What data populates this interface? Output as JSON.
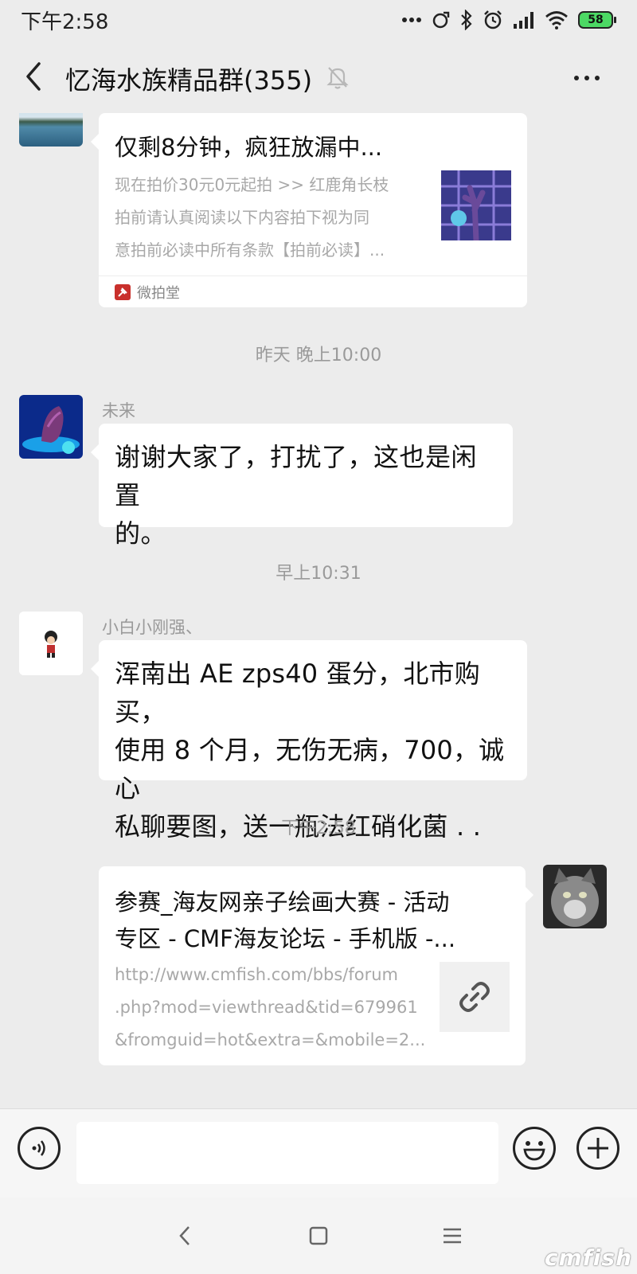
{
  "status_bar": {
    "time": "下午2:58",
    "battery": "58",
    "colors": {
      "battery_fill": "#4cd964"
    },
    "icons": [
      "more-dots-icon",
      "alarm-ring-icon",
      "bluetooth-icon",
      "alarm-clock-icon",
      "signal-icon",
      "wifi-icon",
      "battery-icon"
    ]
  },
  "header": {
    "title": "忆海水族精品群(355)",
    "back_icon": "chevron-left-icon",
    "mute_icon": "bell-off-icon",
    "more_icon": "more-horizontal-icon"
  },
  "messages": [
    {
      "type": "card",
      "side": "left",
      "title": "仅剩8分钟，疯狂放漏中...",
      "description": [
        "现在拍价30元0元起拍 >> 红鹿角长枝",
        "拍前请认真阅读以下内容拍下视为同",
        "意拍前必读中所有条款【拍前必读】..."
      ],
      "source": "微拍堂"
    },
    {
      "type": "timestamp",
      "text": "昨天 晚上10:00"
    },
    {
      "type": "text",
      "side": "left",
      "sender": "未来",
      "lines": [
        "谢谢大家了，打扰了，这也是闲置",
        "的。"
      ]
    },
    {
      "type": "timestamp",
      "text": "早上10:31"
    },
    {
      "type": "text",
      "side": "left",
      "sender": "小白小刚强、",
      "lines": [
        "浑南出 AE zps40 蛋分，北市购买，",
        "使用 8 个月，无伤无病，700，诚心",
        "私聊要图，送一瓶法红硝化菌 . ."
      ]
    },
    {
      "type": "timestamp",
      "text": "下午2:58"
    },
    {
      "type": "link_card",
      "side": "right",
      "title": [
        "参赛_海友网亲子绘画大赛 - 活动",
        "专区 - CMF海友论坛 - 手机版 -..."
      ],
      "url_lines": [
        "http://www.cmfish.com/bbs/forum",
        ".php?mod=viewthread&tid=679961",
        "&fromguid=hot&extra=&mobile=2..."
      ],
      "thumb_icon": "link-icon"
    }
  ],
  "input_bar": {
    "voice_icon": "voice-icon",
    "emoji_icon": "emoji-icon",
    "plus_icon": "plus-icon",
    "placeholder": ""
  },
  "nav_bar": {
    "back_icon": "nav-back-icon",
    "home_icon": "nav-home-icon",
    "menu_icon": "nav-menu-icon"
  },
  "watermark": "cmfish"
}
